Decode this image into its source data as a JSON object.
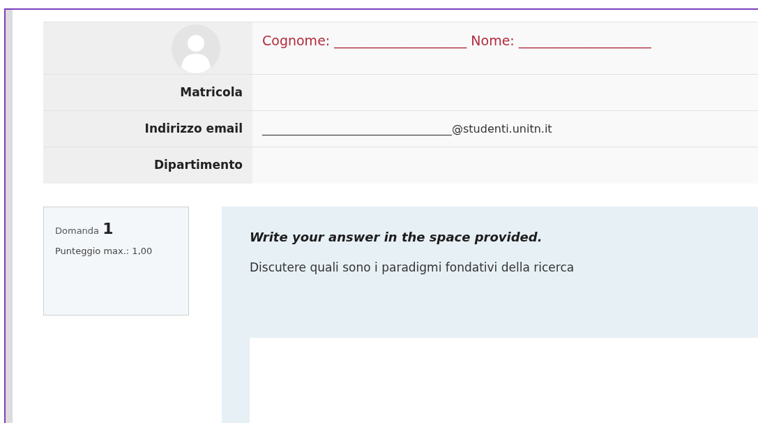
{
  "profile": {
    "name_line": "Cognome: ____________________ Nome: ____________________",
    "fields": [
      {
        "label": "Matricola"
      },
      {
        "label": "Indirizzo email",
        "value": "__________________________________@studenti.unitn.it"
      },
      {
        "label": "Dipartimento"
      }
    ]
  },
  "question": {
    "label": "Domanda",
    "number": "1",
    "grade": "Punteggio max.: 1,00",
    "instruction": "Write your answer in the space provided.",
    "text": "Discutere quali sono i paradigmi fondativi della ricerca"
  }
}
